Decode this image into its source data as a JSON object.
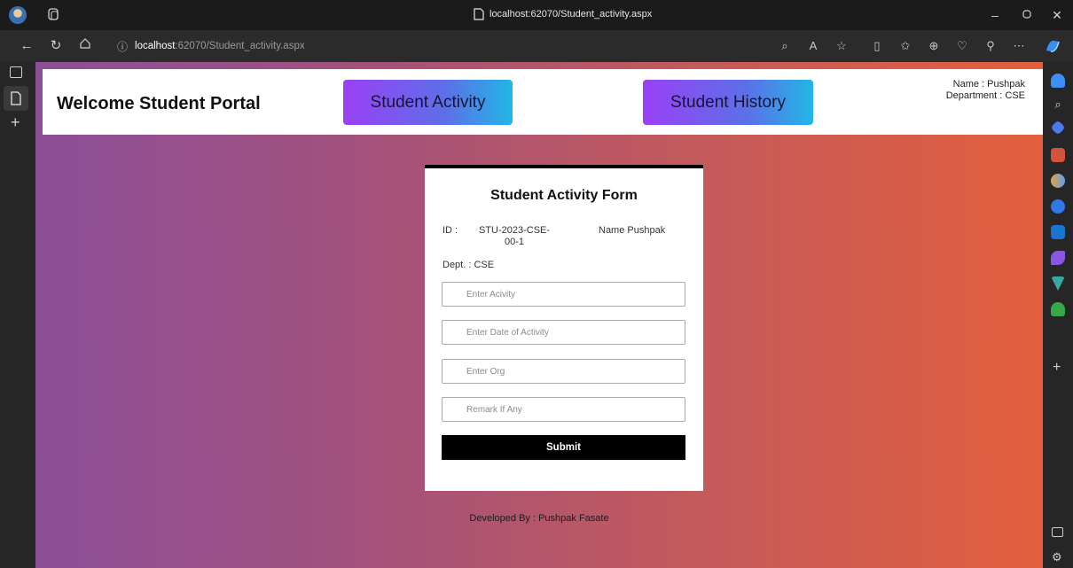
{
  "browser": {
    "tab_title": "localhost:62070/Student_activity.aspx",
    "url_host": "localhost",
    "url_rest": ":62070/Student_activity.aspx",
    "icons": [
      "profile-avatar-icon",
      "tab-actions-icon",
      "back-icon",
      "refresh-icon",
      "home-icon",
      "info-icon",
      "zoom-icon",
      "read-aloud-icon",
      "favorite-icon",
      "split-screen-icon",
      "favorites-icon",
      "collections-icon",
      "browser-essentials-icon",
      "extensions-icon",
      "more-icon",
      "copilot-icon"
    ]
  },
  "header": {
    "brand": "Welcome Student Portal",
    "nav": [
      {
        "label": "Student Activity"
      },
      {
        "label": "Student History"
      }
    ],
    "user_name": "Name : Pushpak",
    "user_department": "Department : CSE"
  },
  "form": {
    "title": "Student Activity Form",
    "id_label": "ID :",
    "id_value_line1": "STU-2023-CSE-",
    "id_value_line2": "00-1",
    "name_label": "Name",
    "name_value": "Pushpak",
    "dept_label": "Dept. :",
    "dept_value": "CSE",
    "fields": [
      {
        "placeholder": "Enter Acivity",
        "value": ""
      },
      {
        "placeholder": "Enter Date of Activity",
        "value": ""
      },
      {
        "placeholder": "Enter Org",
        "value": ""
      },
      {
        "placeholder": "Remark If Any",
        "value": ""
      }
    ],
    "submit_label": "Submit"
  },
  "footer": {
    "text": "Developed By : Pushpak Fasate"
  },
  "colors": {
    "nav_gradient_start": "#9b40f5",
    "nav_gradient_end": "#20b7e6",
    "bg_gradient_start": "#8d4f98",
    "bg_gradient_end": "#e35f3d"
  }
}
